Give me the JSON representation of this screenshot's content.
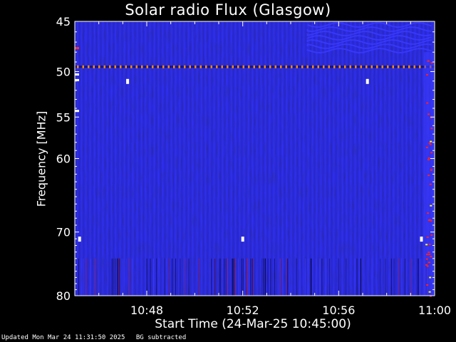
{
  "chart_data": {
    "type": "heatmap",
    "title": "Solar radio Flux (Glasgow)",
    "xlabel": "Start Time (24-Mar-25 10:45:00)",
    "ylabel": "Frequency [MHz]",
    "x_ticks": [
      {
        "label": "10:48",
        "minutes": 3
      },
      {
        "label": "10:52",
        "minutes": 7
      },
      {
        "label": "10:56",
        "minutes": 11
      },
      {
        "label": "11:00",
        "minutes": 15
      }
    ],
    "xlim_minutes": [
      0,
      15
    ],
    "y_ticks": [
      45,
      50,
      55,
      60,
      70,
      80
    ],
    "ylim_mhz": [
      45,
      80
    ],
    "y_scale": "log",
    "grid": false,
    "colormap": [
      "#05053a",
      "#1818c8",
      "#3a3aff",
      "#c01818",
      "#ffff00",
      "#ffffff"
    ],
    "features": [
      {
        "kind": "interference_line",
        "freq_mhz": 49.5,
        "color": "#ff8a00"
      },
      {
        "kind": "wave_pattern",
        "freq_range_mhz": [
          45,
          49
        ],
        "minutes_range": [
          9.7,
          15
        ]
      },
      {
        "kind": "burst_column",
        "minutes": 14.7,
        "freq_range_mhz": [
          48,
          80
        ],
        "color": "#ff2020"
      }
    ],
    "spots": [
      {
        "minutes": 0.2,
        "freq_mhz": 71
      },
      {
        "minutes": 7.0,
        "freq_mhz": 71
      },
      {
        "minutes": 14.45,
        "freq_mhz": 71
      },
      {
        "minutes": 2.2,
        "freq_mhz": 51
      },
      {
        "minutes": 12.2,
        "freq_mhz": 51
      }
    ]
  },
  "footer": {
    "updated": "Updated Mon Mar 24 11:31:50 2025",
    "note": "BG subtracted"
  }
}
